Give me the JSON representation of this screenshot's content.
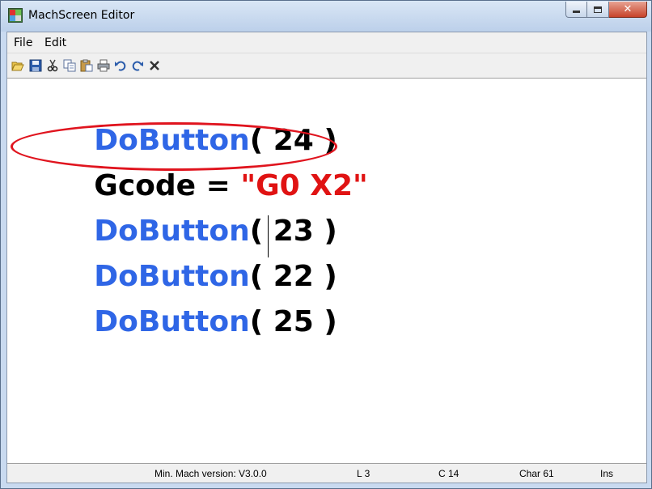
{
  "window": {
    "title": "MachScreen Editor",
    "buttons": {
      "minimize": "minimize",
      "maximize": "maximize",
      "close": "close"
    }
  },
  "menu": {
    "file": "File",
    "edit": "Edit"
  },
  "toolbar": [
    {
      "name": "open-icon"
    },
    {
      "name": "save-icon"
    },
    {
      "name": "cut-icon"
    },
    {
      "name": "copy-icon"
    },
    {
      "name": "paste-icon"
    },
    {
      "name": "print-icon"
    },
    {
      "name": "undo-icon"
    },
    {
      "name": "redo-icon"
    },
    {
      "name": "delete-icon"
    }
  ],
  "editor": {
    "lines": [
      {
        "kw": "DoButton",
        "rest": "( 24 )"
      },
      {
        "ident": "Gcode = ",
        "str": "\"G0 X2\""
      },
      {
        "kw": "DoButton",
        "rest": "( 23 )"
      },
      {
        "kw": "DoButton",
        "rest": "( 22 )"
      },
      {
        "kw": "DoButton",
        "rest": "( 25 )"
      }
    ],
    "colors": {
      "keyword": "#2f66e6",
      "text": "#000000",
      "string": "#e01313",
      "highlight": "#e0141e"
    }
  },
  "status": {
    "version": "Min. Mach version: V3.0.0",
    "line": "L  3",
    "col": "C  14",
    "char": "Char  61",
    "mode": "Ins"
  }
}
